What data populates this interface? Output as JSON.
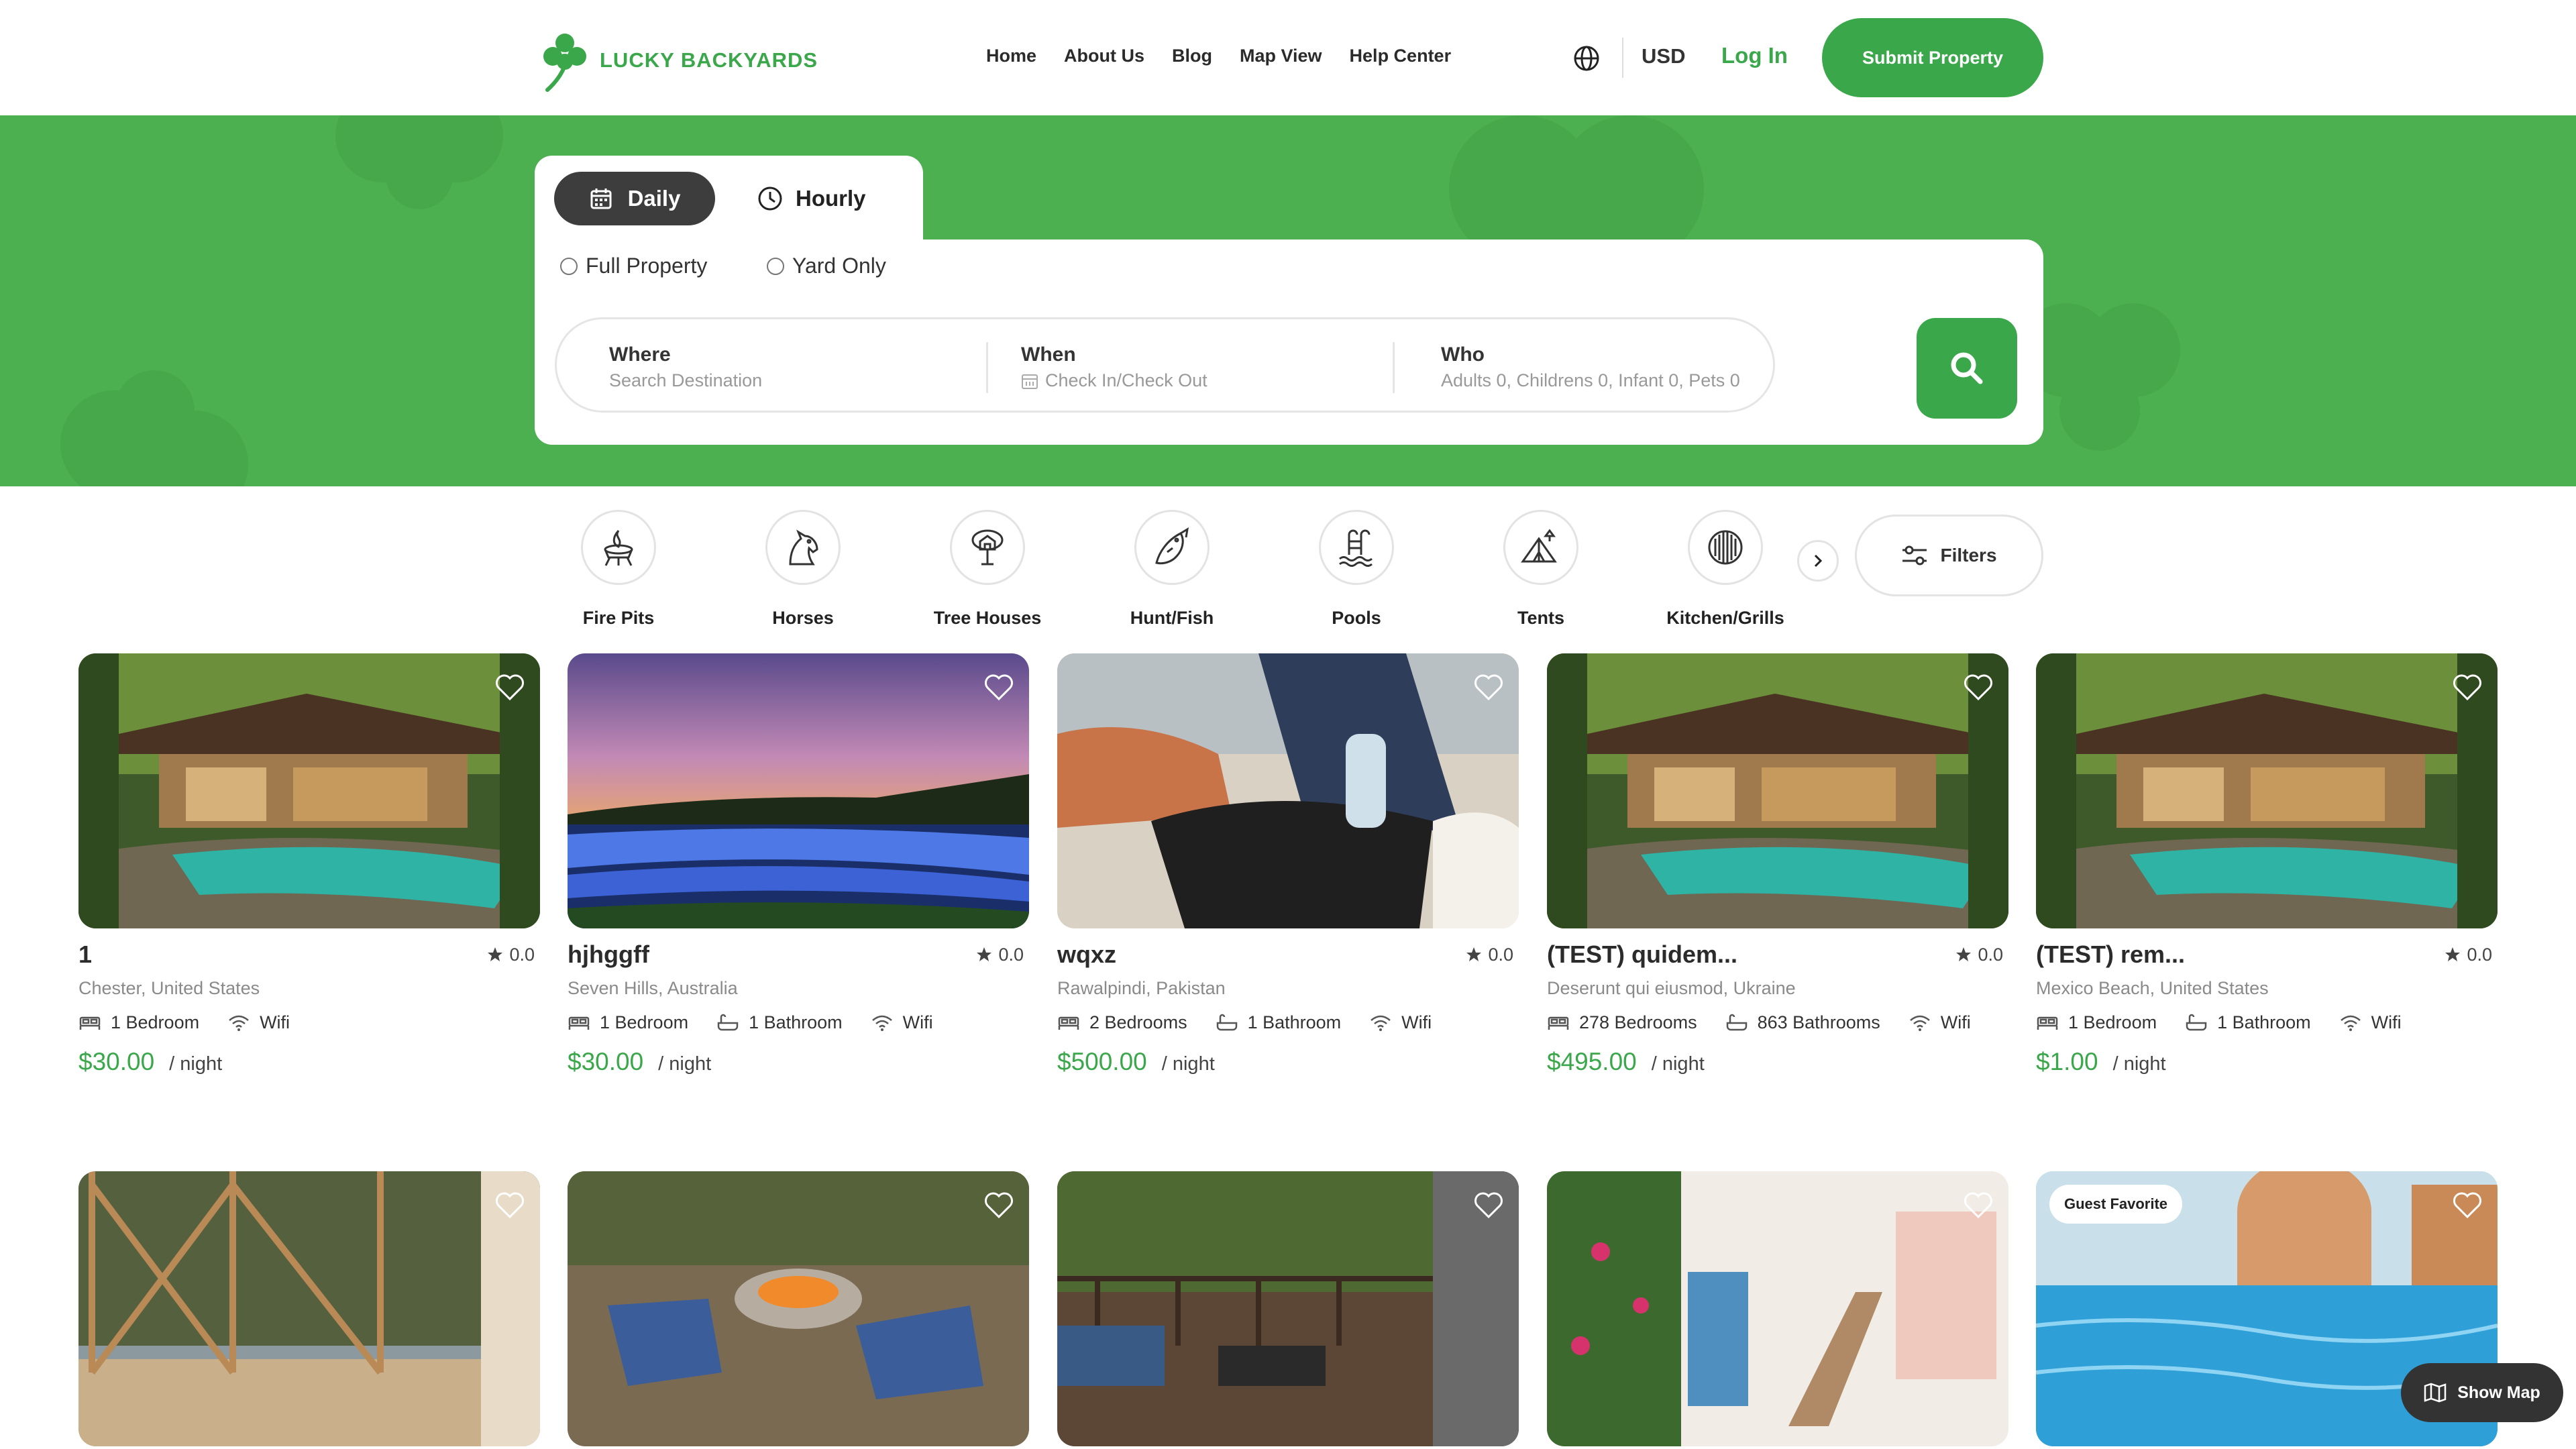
{
  "header": {
    "logo_text": "LUCKY BACKYARDS",
    "nav": [
      "Home",
      "About Us",
      "Blog",
      "Map View",
      "Help Center"
    ],
    "currency": "USD",
    "login": "Log In",
    "submit": "Submit Property"
  },
  "search": {
    "tabs": {
      "daily": "Daily",
      "hourly": "Hourly"
    },
    "radios": {
      "full": "Full Property",
      "yard": "Yard Only"
    },
    "where": {
      "label": "Where",
      "hint": "Search Destination"
    },
    "when": {
      "label": "When",
      "hint": "Check In/Check Out"
    },
    "who": {
      "label": "Who",
      "hint": "Adults 0, Childrens 0, Infant 0, Pets 0"
    }
  },
  "categories": [
    "Fire Pits",
    "Horses",
    "Tree Houses",
    "Hunt/Fish",
    "Pools",
    "Tents",
    "Kitchen/Grills"
  ],
  "filters_label": "Filters",
  "listings": [
    {
      "title": "1",
      "rating": "0.0",
      "location": "Chester, United States",
      "amenities": [
        "1 Bedroom",
        "Wifi"
      ],
      "price": "$30.00",
      "per": "/ night"
    },
    {
      "title": "hjhggff",
      "rating": "0.0",
      "location": "Seven Hills, Australia",
      "amenities": [
        "1 Bedroom",
        "1 Bathroom",
        "Wifi"
      ],
      "price": "$30.00",
      "per": "/ night"
    },
    {
      "title": "wqxz",
      "rating": "0.0",
      "location": "Rawalpindi, Pakistan",
      "amenities": [
        "2 Bedrooms",
        "1 Bathroom",
        "Wifi"
      ],
      "price": "$500.00",
      "per": "/ night"
    },
    {
      "title": "(TEST) quidem...",
      "rating": "0.0",
      "location": "Deserunt qui eiusmod, Ukraine",
      "amenities": [
        "278 Bedrooms",
        "863 Bathrooms",
        "Wifi"
      ],
      "price": "$495.00",
      "per": "/ night"
    },
    {
      "title": "(TEST) rem...",
      "rating": "0.0",
      "location": "Mexico Beach, United States",
      "amenities": [
        "1 Bedroom",
        "1 Bathroom",
        "Wifi"
      ],
      "price": "$1.00",
      "per": "/ night"
    }
  ],
  "guest_favorite": "Guest Favorite",
  "show_map": "Show Map",
  "colors": {
    "brand_green": "#3aa84a",
    "hero_green": "#4caf50",
    "dark": "#3d3d3d"
  }
}
